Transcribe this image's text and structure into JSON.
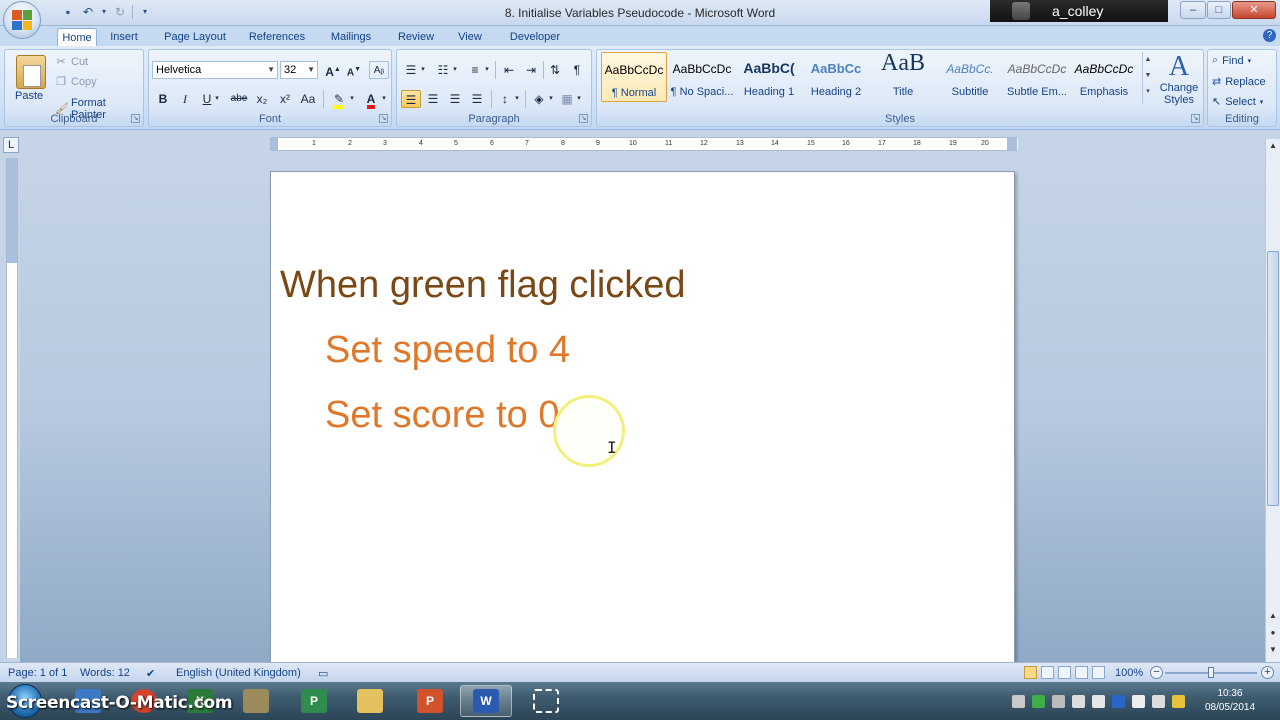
{
  "window": {
    "title": "8. Initialise Variables Pseudocode - Microsoft Word",
    "user": "a_colley",
    "controls": [
      "–",
      "□",
      "✕"
    ]
  },
  "ribbon_tabs": [
    "Home",
    "Insert",
    "Page Layout",
    "References",
    "Mailings",
    "Review",
    "View",
    "Developer"
  ],
  "clipboard": {
    "paste": "Paste",
    "cut": "Cut",
    "copy": "Copy",
    "format_painter": "Format Painter",
    "group_label": "Clipboard"
  },
  "font": {
    "name": "Helvetica",
    "size": "32",
    "group_label": "Font",
    "buttons": [
      "B",
      "I",
      "U",
      "abe",
      "x₂",
      "x²",
      "Aa"
    ]
  },
  "paragraph": {
    "group_label": "Paragraph",
    "pilcrow": "¶"
  },
  "styles": {
    "group_label": "Styles",
    "items": [
      {
        "preview": "AaBbCcDc",
        "name": "¶ Normal"
      },
      {
        "preview": "AaBbCcDc",
        "name": "¶ No Spaci..."
      },
      {
        "preview": "AaBbC(",
        "name": "Heading 1"
      },
      {
        "preview": "AaBbCc",
        "name": "Heading 2"
      },
      {
        "preview": "AaB",
        "name": "Title"
      },
      {
        "preview": "AaBbCc.",
        "name": "Subtitle"
      },
      {
        "preview": "AaBbCcDc",
        "name": "Subtle Em..."
      },
      {
        "preview": "AaBbCcDc",
        "name": "Emphasis"
      }
    ],
    "change_styles": "Change Styles"
  },
  "editing": {
    "find": "Find",
    "replace": "Replace",
    "select": "Select",
    "group_label": "Editing"
  },
  "ruler": {
    "ticks": [
      "1",
      "2",
      "3",
      "4",
      "5",
      "6",
      "7",
      "8",
      "9",
      "10",
      "11",
      "12",
      "13",
      "14",
      "15",
      "16",
      "17",
      "18",
      "19",
      "20"
    ]
  },
  "document": {
    "lines": [
      "When green flag clicked",
      "Set speed to 4",
      "Set score to 0"
    ],
    "colors": {
      "heading": "#7a4814",
      "body": "#e0782a"
    }
  },
  "status": {
    "page": "Page: 1 of 1",
    "words": "Words: 12",
    "language": "English (United Kingdom)",
    "zoom": "100%"
  },
  "taskbar": {
    "watermark": "Screencast-O-Matic.com",
    "time": "10:36",
    "date": "08/05/2014"
  }
}
